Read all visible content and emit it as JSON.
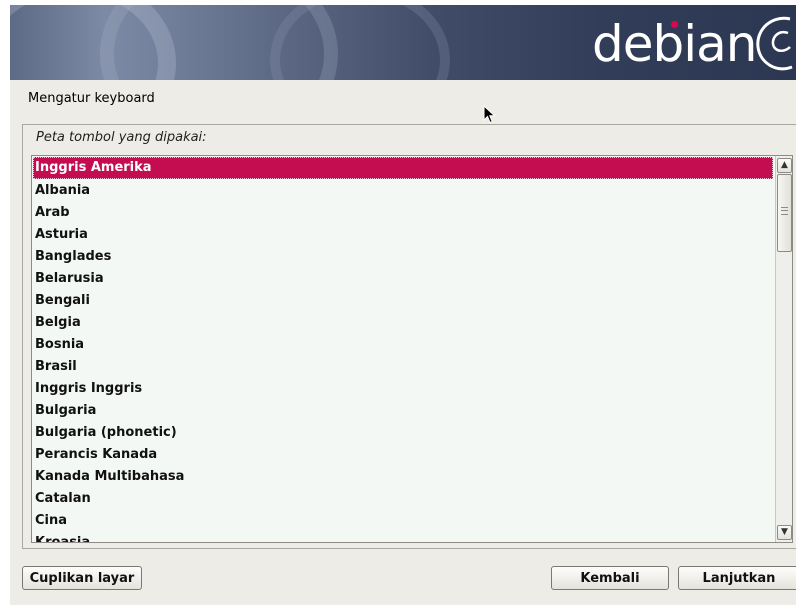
{
  "banner": {
    "logo_text": "debian",
    "logo_dot_color": "#d70751"
  },
  "step_title": "Mengatur keyboard",
  "keymap": {
    "label": "Peta tombol yang dipakai:",
    "selected_index": 0,
    "options": [
      "Inggris Amerika",
      "Albania",
      "Arab",
      "Asturia",
      "Banglades",
      "Belarusia",
      "Bengali",
      "Belgia",
      "Bosnia",
      "Brasil",
      "Inggris Inggris",
      "Bulgaria",
      "Bulgaria (phonetic)",
      "Perancis Kanada",
      "Kanada Multibahasa",
      "Catalan",
      "Cina",
      "Kroasia"
    ]
  },
  "buttons": {
    "screenshot": "Cuplikan layar",
    "back": "Kembali",
    "continue": "Lanjutkan"
  },
  "colors": {
    "selection": "#c40d51",
    "window_bg": "#edece6",
    "list_bg": "#f4f8f5"
  }
}
